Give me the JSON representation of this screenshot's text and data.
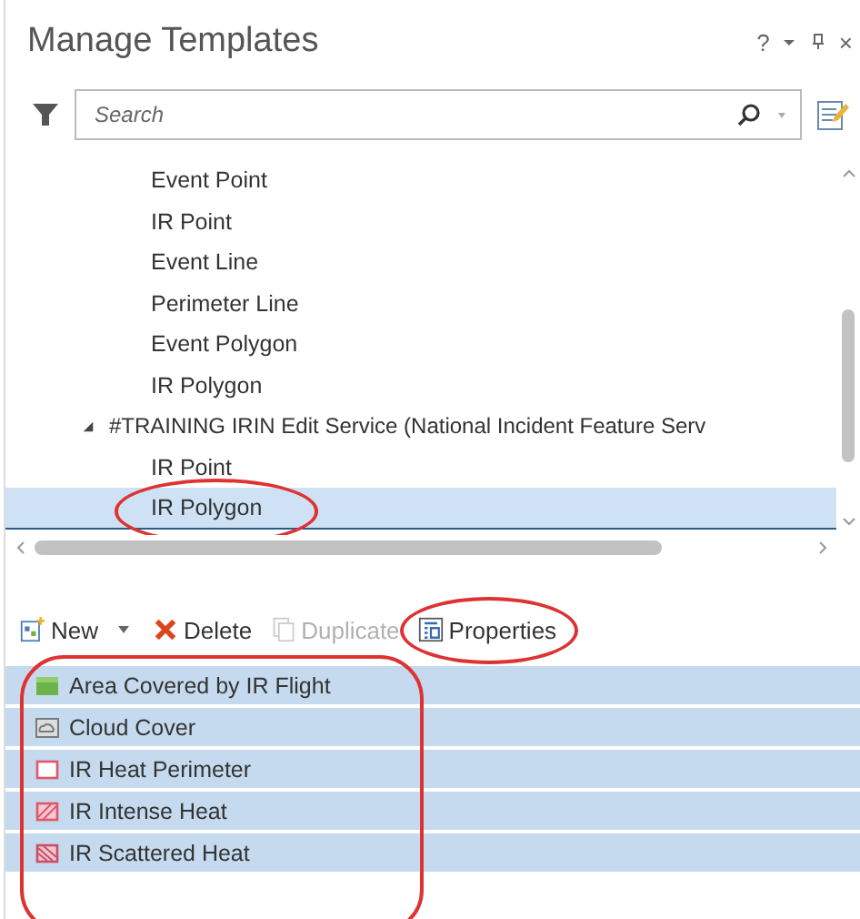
{
  "window": {
    "title": "Manage Templates",
    "controls": [
      "?",
      "×"
    ]
  },
  "search": {
    "placeholder": "Search"
  },
  "tree": {
    "items": [
      {
        "label": "Event Point",
        "selected": false,
        "circled": false
      },
      {
        "label": "IR Point",
        "selected": false,
        "circled": false
      },
      {
        "label": "Event Line",
        "selected": false,
        "circled": false
      },
      {
        "label": "Perimeter Line",
        "selected": false,
        "circled": false
      },
      {
        "label": "Event Polygon",
        "selected": false,
        "circled": false
      },
      {
        "label": "IR Polygon",
        "selected": false,
        "circled": false
      },
      {
        "label": "#TRAINING IRIN Edit Service (National Incident Feature Serv",
        "expanded": true,
        "children": [
          {
            "label": "IR Point",
            "selected": false,
            "circled": false
          },
          {
            "label": "IR Polygon",
            "selected": true,
            "circled": true
          }
        ]
      }
    ]
  },
  "toolbar": [
    {
      "kind": "new",
      "label": "New",
      "disabled": false,
      "circled": false
    },
    {
      "kind": "delete",
      "label": "Delete",
      "disabled": false,
      "circled": false
    },
    {
      "kind": "duplicate",
      "label": "Duplicate",
      "disabled": true,
      "circled": false
    },
    {
      "kind": "properties",
      "label": "Properties",
      "disabled": false,
      "circled": true
    }
  ],
  "templates": {
    "circled": true,
    "items": [
      {
        "label": "Area Covered by IR Flight",
        "kind": "solid",
        "color": "#6cb34a",
        "selected": true
      },
      {
        "label": "Cloud Cover",
        "kind": "cloud",
        "color": "#7a7a7a",
        "selected": true
      },
      {
        "label": "IR Heat Perimeter",
        "kind": "outline",
        "color": "#e0566a",
        "selected": true
      },
      {
        "label": "IR Intense Heat",
        "kind": "hatch",
        "color": "#e0566a",
        "selected": true
      },
      {
        "label": "IR Scattered Heat",
        "kind": "crosshatch",
        "color": "#c9506a",
        "selected": true
      }
    ]
  }
}
